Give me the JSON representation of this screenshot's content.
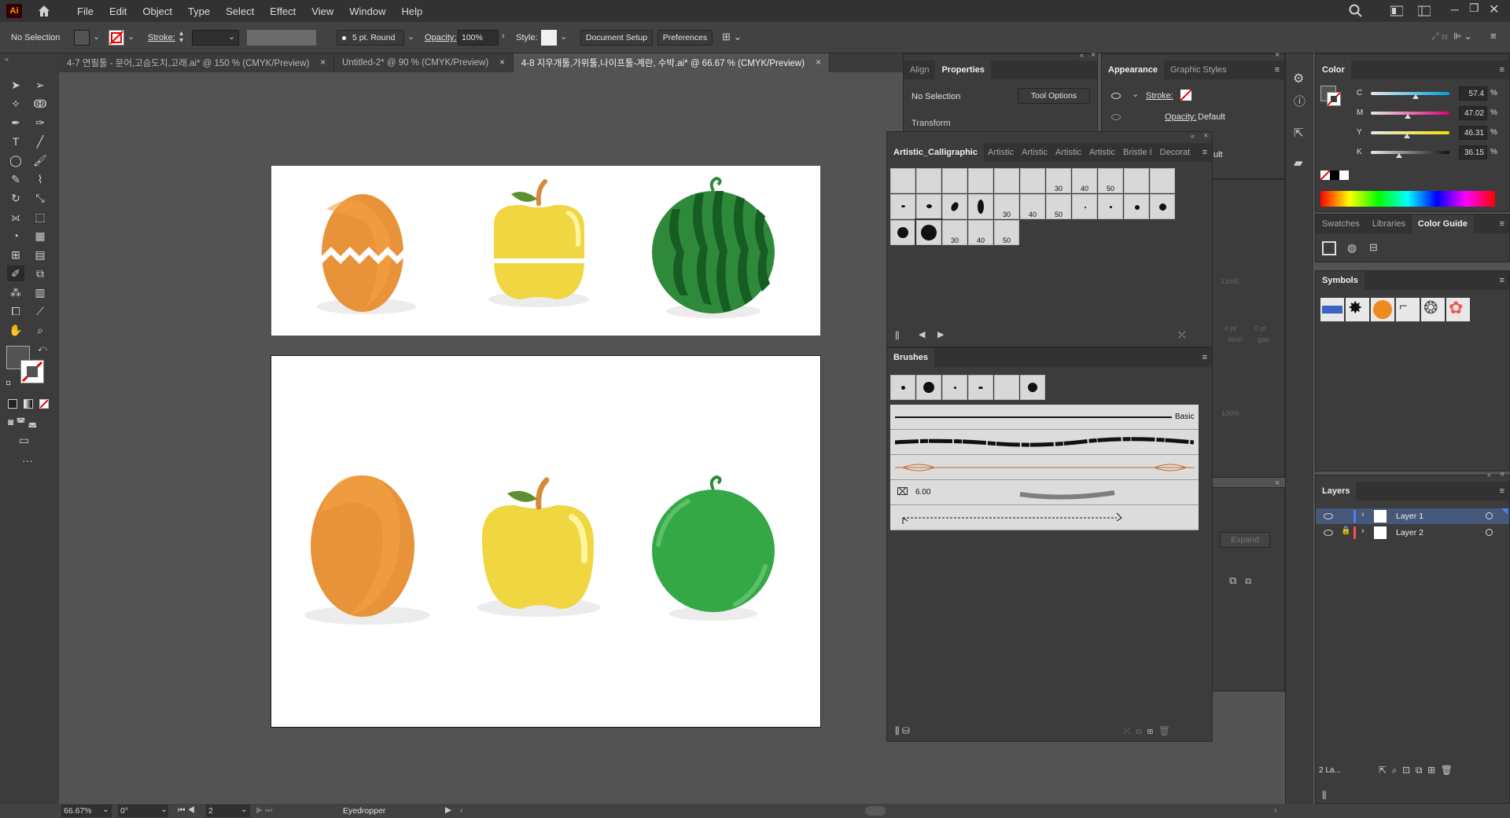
{
  "menubar": {
    "logo": "Ai",
    "items": [
      "File",
      "Edit",
      "Object",
      "Type",
      "Select",
      "Effect",
      "View",
      "Window",
      "Help"
    ]
  },
  "controlbar": {
    "selection": "No Selection",
    "stroke_label": "Stroke:",
    "brush": "5 pt. Round",
    "opacity_label": "Opacity:",
    "opacity_value": "100%",
    "style_label": "Style:",
    "document_setup": "Document Setup",
    "preferences": "Preferences"
  },
  "tabs": [
    {
      "label": "4-7 연필툴 - 문어,고슴도치,고래.ai* @ 150 % (CMYK/Preview)",
      "close": "×"
    },
    {
      "label": "Untitled-2* @ 90 % (CMYK/Preview)",
      "close": "×"
    },
    {
      "label": "4-8 지우개툴,가위툴,나이프툴-계란, 수박.ai* @ 66.67 % (CMYK/Preview)",
      "close": "×"
    }
  ],
  "properties_panel": {
    "tabs": [
      "Align",
      "Properties"
    ],
    "selection": "No Selection",
    "tool_options": "Tool Options",
    "transform": "Transform"
  },
  "appearance_panel": {
    "tabs": [
      "Appearance",
      "Graphic Styles"
    ],
    "stroke_label": "Stroke:",
    "opacity_label": "Opacity:",
    "opacity_value": "Default",
    "partial_value": "ult"
  },
  "calligraphic_panel": {
    "tabs": [
      "Artistic_Calligraphic",
      "Artistic",
      "Artistic",
      "Artistic",
      "Artistic",
      "Bristle I",
      "Decorat"
    ],
    "row1_labels": [
      "",
      "",
      "",
      "",
      "",
      "",
      "30",
      "40",
      "50",
      "",
      ""
    ],
    "row2_labels": [
      "",
      "",
      "",
      "",
      "30",
      "40",
      "50",
      "",
      "",
      "",
      ""
    ],
    "row3_labels": [
      "",
      "",
      "30",
      "40",
      "50"
    ]
  },
  "brushes_panel": {
    "title": "Brushes",
    "basic_label": "Basic",
    "pattern_value": "6.00"
  },
  "stroke_panel_hidden": {
    "limit": "Limit:",
    "dash": "dash",
    "gap": "gap",
    "pt1": "0 pt",
    "pt2": "0 pt",
    "percent": "100%",
    "expand": "Expand"
  },
  "color_panel": {
    "title": "Color",
    "channels": [
      {
        "label": "C",
        "value": "57.4",
        "unit": "%",
        "level": 0.574
      },
      {
        "label": "M",
        "value": "47.02",
        "unit": "%",
        "level": 0.4702
      },
      {
        "label": "Y",
        "value": "46.31",
        "unit": "%",
        "level": 0.4631
      },
      {
        "label": "K",
        "value": "36.15",
        "unit": "%",
        "level": 0.3615
      }
    ]
  },
  "swatches_panel": {
    "tabs": [
      "Swatches",
      "Libraries",
      "Color Guide"
    ]
  },
  "symbols_panel": {
    "title": "Symbols"
  },
  "layers_panel": {
    "title": "Layers",
    "layers": [
      {
        "name": "Layer 1",
        "color": "#4f7bff"
      },
      {
        "name": "Layer 2",
        "color": "#ff4f4f"
      }
    ],
    "count": "2 La..."
  },
  "statusbar": {
    "zoom": "66.67%",
    "rotation": "0°",
    "artboard": "2",
    "tool": "Eyedropper"
  }
}
